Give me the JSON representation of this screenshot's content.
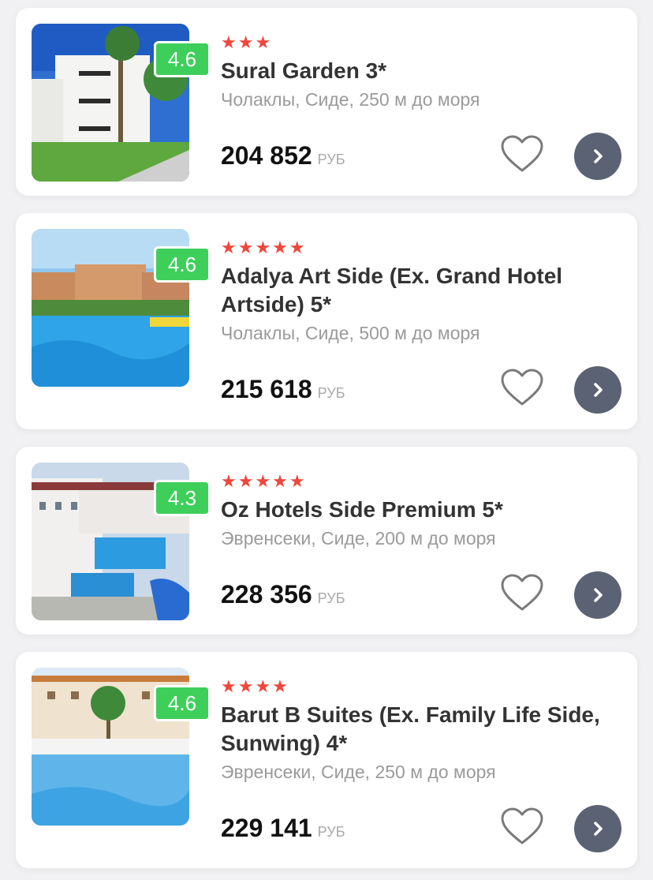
{
  "colors": {
    "rating_badge": "#3ecf5b",
    "stars": "#f0463c",
    "arrow_button": "#5a6273",
    "location_text": "#9a9a9a"
  },
  "hotels": [
    {
      "stars": "★★★",
      "star_count": 3,
      "rating": "4.6",
      "name": "Sural Garden 3*",
      "location": "Чолаклы, Сиде, 250 м до моря",
      "price": "204 852",
      "currency": "РУБ",
      "favorite_icon": "heart-outline-icon",
      "go_icon": "chevron-right-icon"
    },
    {
      "stars": "★★★★★",
      "star_count": 5,
      "rating": "4.6",
      "name": "Adalya Art Side (Ex. Grand Hotel Artside) 5*",
      "location": "Чолаклы, Сиде, 500 м до моря",
      "price": "215 618",
      "currency": "РУБ",
      "favorite_icon": "heart-outline-icon",
      "go_icon": "chevron-right-icon"
    },
    {
      "stars": "★★★★★",
      "star_count": 5,
      "rating": "4.3",
      "name": "Oz Hotels Side Premium 5*",
      "location": "Эвренсеки, Сиде, 200 м до моря",
      "price": "228 356",
      "currency": "РУБ",
      "favorite_icon": "heart-outline-icon",
      "go_icon": "chevron-right-icon"
    },
    {
      "stars": "★★★★",
      "star_count": 4,
      "rating": "4.6",
      "name": "Barut B Suites (Ex. Family Life Side, Sunwing) 4*",
      "location": "Эвренсеки, Сиде, 250 м до моря",
      "price": "229 141",
      "currency": "РУБ",
      "favorite_icon": "heart-outline-icon",
      "go_icon": "chevron-right-icon"
    }
  ]
}
